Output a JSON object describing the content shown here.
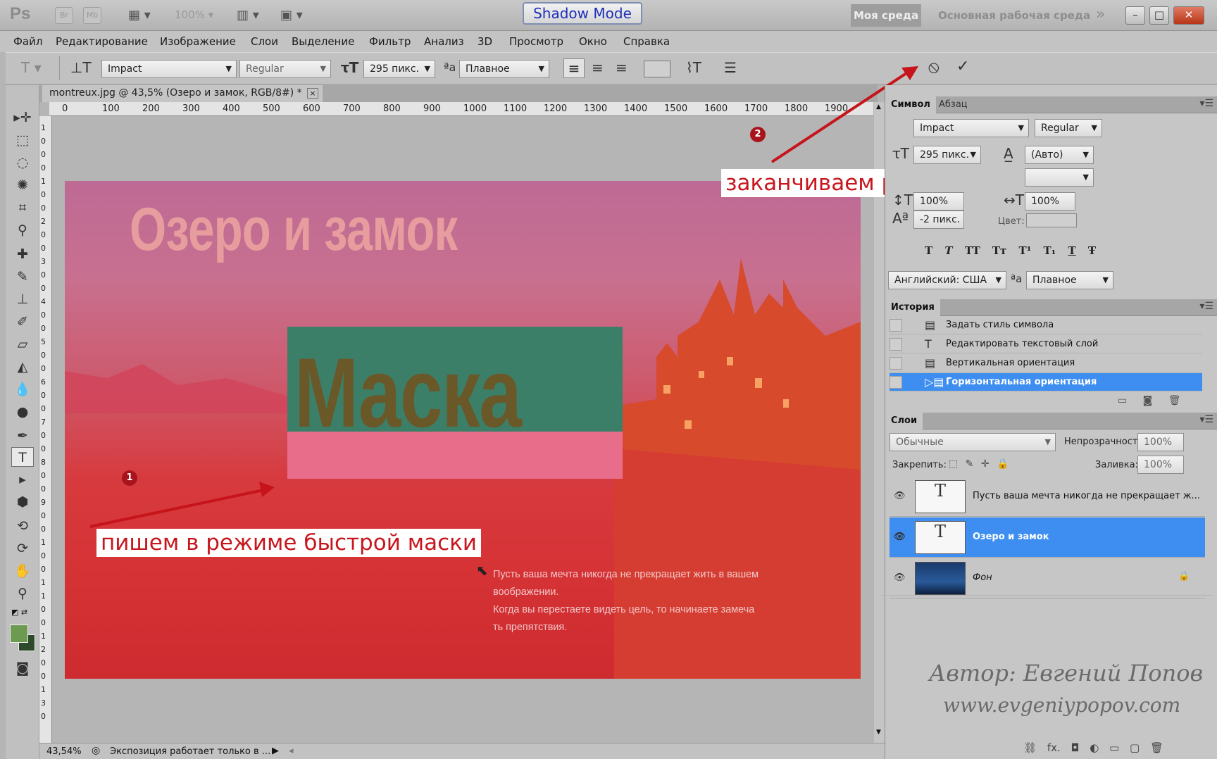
{
  "app": {
    "logo": "Ps",
    "br": "Br",
    "mb": "Mb",
    "zoom": "100%",
    "shadow_mode": "Shadow Mode",
    "workspace_active": "Моя среда",
    "workspace_other": "Основная рабочая среда",
    "more": "»"
  },
  "window": {
    "minimize": "–",
    "restore": "□",
    "close": "✕"
  },
  "menu": [
    "Файл",
    "Редактирование",
    "Изображение",
    "Слои",
    "Выделение",
    "Фильтр",
    "Анализ",
    "3D",
    "Просмотр",
    "Окно",
    "Справка"
  ],
  "options": {
    "font": "Impact",
    "style": "Regular",
    "size": "295 пикс.",
    "aa_label": "a",
    "aa": "Плавное",
    "cancel": "⦸",
    "commit": "✓"
  },
  "document": {
    "tab": "montreux.jpg @ 43,5% (Озеро и замок, RGB/8#) *",
    "close": "×"
  },
  "ruler_top": [
    "0",
    "100",
    "200",
    "300",
    "400",
    "500",
    "600",
    "700",
    "800",
    "900",
    "1000",
    "1100",
    "1200",
    "1300",
    "1400",
    "1500",
    "1600",
    "1700",
    "1800",
    "1900"
  ],
  "ruler_left": [
    "1",
    "0",
    "0",
    "0",
    "1",
    "0",
    "0",
    "2",
    "0",
    "0",
    "3",
    "0",
    "0",
    "4",
    "0",
    "0",
    "5",
    "0",
    "0",
    "6",
    "0",
    "0",
    "7",
    "0",
    "0",
    "8",
    "0",
    "0",
    "9",
    "0",
    "0",
    "1",
    "0",
    "0",
    "1",
    "1",
    "0",
    "0",
    "1",
    "2",
    "0",
    "0",
    "1",
    "3",
    "0"
  ],
  "image": {
    "title": "Озеро и замок",
    "mask_word": "Маска",
    "paragraph": [
      "Пусть ваша мечта никогда не прекращает жить в вашем",
      "воображении.",
      "Когда вы перестаете видеть цель, то начинаете замеча",
      "ть препятствия."
    ]
  },
  "annotations": {
    "note1": "пишем в режиме быстрой маски",
    "note2": "заканчиваем работу. либо Esc",
    "badge1": "1",
    "badge2": "2"
  },
  "status": {
    "zoom": "43,54%",
    "text": "Экспозиция работает только в ..."
  },
  "character_panel": {
    "tab1": "Символ",
    "tab2": "Абзац",
    "font": "Impact",
    "style": "Regular",
    "size": "295 пикс.",
    "leading": "(Авто)",
    "vscale": "100%",
    "hscale": "100%",
    "baseline": "-2 пикс.",
    "color_label": "Цвет:",
    "styles": [
      "T",
      "T",
      "TT",
      "Tт",
      "T¹",
      "T₁",
      "T",
      "Ŧ"
    ],
    "language": "Английский: США",
    "aa": "Плавное",
    "aa_label": "a"
  },
  "history_panel": {
    "title": "История",
    "items": [
      "Задать стиль символа",
      "Редактировать текстовый слой",
      "Вертикальная ориентация",
      "Горизонтальная ориентация"
    ]
  },
  "layers_panel": {
    "title": "Слои",
    "blend": "Обычные",
    "opacity_label": "Непрозрачность:",
    "opacity": "100%",
    "lock_label": "Закрепить:",
    "fill_label": "Заливка:",
    "fill": "100%",
    "layers": [
      {
        "name": "Пусть ваша мечта никогда не прекращает ж...",
        "thumb": "T"
      },
      {
        "name": "Озеро и замок",
        "thumb": "T"
      },
      {
        "name": "Фон",
        "thumb": ""
      }
    ],
    "footer_icons": [
      "⛓",
      "fx.",
      "◘",
      "◐",
      "▭",
      "▢",
      "🗑"
    ]
  },
  "signature": {
    "line1": "Автор: Евгений Попов",
    "line2": "www.evgeniypopov.com"
  }
}
